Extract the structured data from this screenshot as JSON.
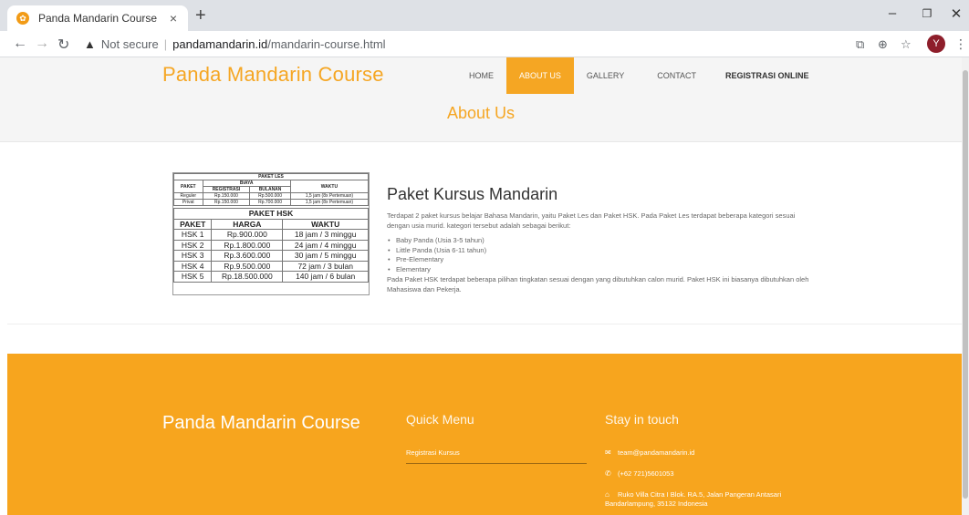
{
  "browser": {
    "tab_title": "Panda Mandarin Course",
    "tab_close": "×",
    "new_tab": "+",
    "not_secure": "Not secure",
    "url_host": "pandamandarin.id",
    "url_path": "/mandarin-course.html",
    "profile_initial": "Y"
  },
  "header": {
    "brand": "Panda Mandarin Course",
    "nav": [
      {
        "label": "HOME"
      },
      {
        "label": "ABOUT US"
      },
      {
        "label": "GALLERY"
      },
      {
        "label": "CONTACT"
      },
      {
        "label": "REGISTRASI ONLINE"
      }
    ],
    "active_color": "#f5a623"
  },
  "page_title": "About Us",
  "price_table": {
    "les_title": "PAKET LES",
    "les_headers": {
      "paket": "PAKET",
      "biaya": "BIAYA",
      "registrasi": "REGISTRASI",
      "bulanan": "BULANAN",
      "waktu": "WAKTU"
    },
    "les_rows": [
      [
        "Reguler",
        "Rp.150.000",
        "Rp.500.000",
        "1,5 jam (8x Pertemuan)"
      ],
      [
        "Privat",
        "Rp.150.000",
        "Rp.700.000",
        "1,5 jam (8x Pertemuan)"
      ]
    ],
    "hsk_title": "PAKET HSK",
    "hsk_headers": [
      "PAKET",
      "HARGA",
      "WAKTU"
    ],
    "hsk_rows": [
      [
        "HSK 1",
        "Rp.900.000",
        "18 jam / 3 minggu"
      ],
      [
        "HSK 2",
        "Rp.1.800.000",
        "24 jam / 4 minggu"
      ],
      [
        "HSK 3",
        "Rp.3.600.000",
        "30 jam / 5 minggu"
      ],
      [
        "HSK 4",
        "Rp.9.500.000",
        "72 jam / 3 bulan"
      ],
      [
        "HSK 5",
        "Rp.18.500.000",
        "140 jam / 6 bulan"
      ]
    ]
  },
  "content": {
    "heading": "Paket Kursus Mandarin",
    "intro": "Terdapat 2 paket kursus belajar Bahasa Mandarin, yaitu Paket Les dan Paket HSK. Pada Paket Les terdapat beberapa kategori sesuai dengan usia murid. kategori tersebut adalah sebagai berikut:",
    "items": [
      "Baby Panda (Usia 3-5 tahun)",
      "Little Panda (Usia 6-11 tahun)",
      "Pre-Elementary",
      "Elementary"
    ],
    "outro": "Pada Paket HSK terdapat beberapa pilihan tingkatan sesuai dengan yang dibutuhkan calon murid. Paket HSK ini biasanya dibutuhkan oleh Mahasiswa dan Pekerja."
  },
  "footer": {
    "brand": "Panda Mandarin Course",
    "quick_menu_title": "Quick Menu",
    "quick_menu_link": "Registrasi Kursus",
    "stay_title": "Stay in touch",
    "email": "team@pandamandarin.id",
    "phone": "(+62 721)5601053",
    "address": "Ruko Villa Citra I Blok. RA.5, Jalan Pangeran Antasari Bandarlampung, 35132 Indonesia",
    "bg_color": "#f7a51e"
  }
}
